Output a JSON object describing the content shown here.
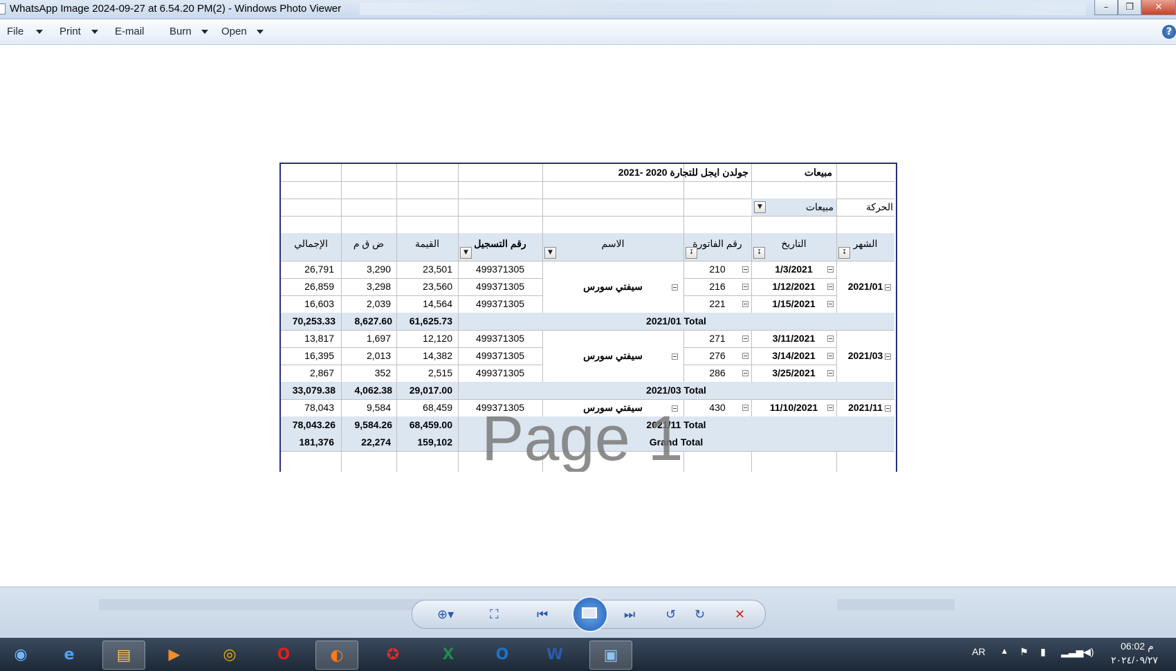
{
  "window": {
    "title": "WhatsApp Image 2024-09-27 at 6.54.20 PM(2) - Windows Photo Viewer",
    "controls": [
      "minimize",
      "maximize",
      "close"
    ]
  },
  "menu": {
    "file": "File",
    "print": "Print",
    "email": "E-mail",
    "burn": "Burn",
    "open": "Open",
    "help": "?"
  },
  "sheet": {
    "title": "مبيعات",
    "company": "جولدن ايجل للتجارة 2020 -2021",
    "filter_label": "الحركة",
    "filter_value": "مبيعات",
    "headers": {
      "month": "الشهر",
      "date": "التاريخ",
      "invoice": "رقم الفاتورة",
      "name": "الاسم",
      "reg": "رقم التسجيل",
      "value": "القيمة",
      "vat": "ض ق م",
      "total": "الإجمالي"
    },
    "groups": [
      {
        "month": "2021/01",
        "name": "سيفتي سورس",
        "rows": [
          {
            "date": "1/3/2021",
            "invoice": "210",
            "reg": "499371305",
            "value": "23,501",
            "vat": "3,290",
            "total": "26,791"
          },
          {
            "date": "1/12/2021",
            "invoice": "216",
            "reg": "499371305",
            "value": "23,560",
            "vat": "3,298",
            "total": "26,859"
          },
          {
            "date": "1/15/2021",
            "invoice": "221",
            "reg": "499371305",
            "value": "14,564",
            "vat": "2,039",
            "total": "16,603"
          }
        ],
        "subtotal_label": "2021/01 Total",
        "subtotal": {
          "value": "61,625.73",
          "vat": "8,627.60",
          "total": "70,253.33"
        }
      },
      {
        "month": "2021/03",
        "name": "سيفتي سورس",
        "rows": [
          {
            "date": "3/11/2021",
            "invoice": "271",
            "reg": "499371305",
            "value": "12,120",
            "vat": "1,697",
            "total": "13,817"
          },
          {
            "date": "3/14/2021",
            "invoice": "276",
            "reg": "499371305",
            "value": "14,382",
            "vat": "2,013",
            "total": "16,395"
          },
          {
            "date": "3/25/2021",
            "invoice": "286",
            "reg": "499371305",
            "value": "2,515",
            "vat": "352",
            "total": "2,867"
          }
        ],
        "subtotal_label": "2021/03 Total",
        "subtotal": {
          "value": "29,017.00",
          "vat": "4,062.38",
          "total": "33,079.38"
        }
      },
      {
        "month": "2021/11",
        "name": "سيفتي سورس",
        "rows": [
          {
            "date": "11/10/2021",
            "invoice": "430",
            "reg": "499371305",
            "value": "68,459",
            "vat": "9,584",
            "total": "78,043"
          }
        ],
        "subtotal_label": "2021/11 Total",
        "subtotal": {
          "value": "68,459.00",
          "vat": "9,584.26",
          "total": "78,043.26"
        }
      }
    ],
    "grand_total": {
      "label": "Grand Total",
      "value": "159,102",
      "vat": "22,274",
      "total": "181,376"
    },
    "watermark": "Page 1"
  },
  "viewer_controls": [
    "zoom-icon",
    "actual-size-icon",
    "previous-icon",
    "slideshow-icon",
    "next-icon",
    "rotate-ccw-icon",
    "rotate-cw-icon",
    "delete-icon"
  ],
  "taskbar": {
    "apps": [
      "start-orb",
      "internet-explorer",
      "file-explorer",
      "media-player",
      "chrome",
      "opera",
      "firefox",
      "app-red",
      "excel",
      "outlook",
      "word",
      "photo-viewer"
    ],
    "language": "AR",
    "time": "06:02 م",
    "date": "٢٠٢٤/٠٩/٢٧"
  }
}
